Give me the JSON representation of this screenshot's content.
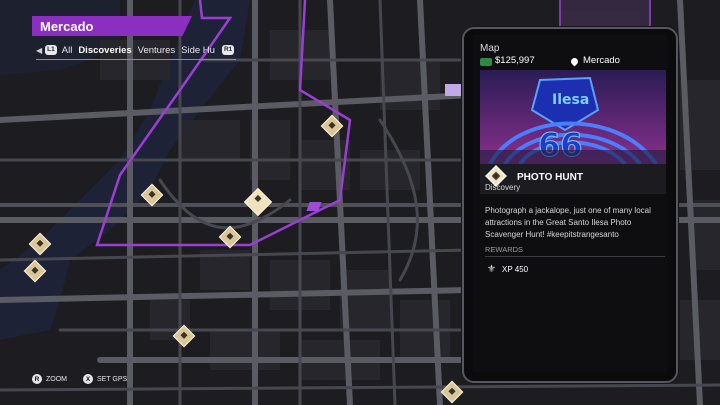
{
  "region": {
    "name": "Mercado"
  },
  "filters": {
    "left_button": "L1",
    "right_button": "R1",
    "tabs": [
      {
        "label": "All",
        "active": false
      },
      {
        "label": "Discoveries",
        "active": true
      },
      {
        "label": "Ventures",
        "active": false
      },
      {
        "label": "Side Hu",
        "active": false
      }
    ]
  },
  "prompts": [
    {
      "button": "R",
      "label": "ZOOM"
    },
    {
      "button": "X",
      "label": "SET GPS"
    }
  ],
  "phone": {
    "app_title": "Map",
    "money": "$125,997",
    "location": "Mercado",
    "card": {
      "title": "PHOTO HUNT",
      "subtitle": "Discovery",
      "description": "Photograph a jackalope, just one of many local attractions in the Great Santo Ilesa Photo Scavenger Hunt! #keepitstrangesanto",
      "rewards_label": "REWARDS",
      "reward": "XP 450"
    }
  },
  "colors": {
    "accent": "#8a2fc0",
    "marker": "#d9c79a",
    "map_bg": "#1b1b1f",
    "water": "#1e2236"
  },
  "icons": [
    "money-icon",
    "location-pin-icon",
    "fleur-de-lis-icon",
    "photo-hunt-icon",
    "discovery-marker-icon"
  ]
}
